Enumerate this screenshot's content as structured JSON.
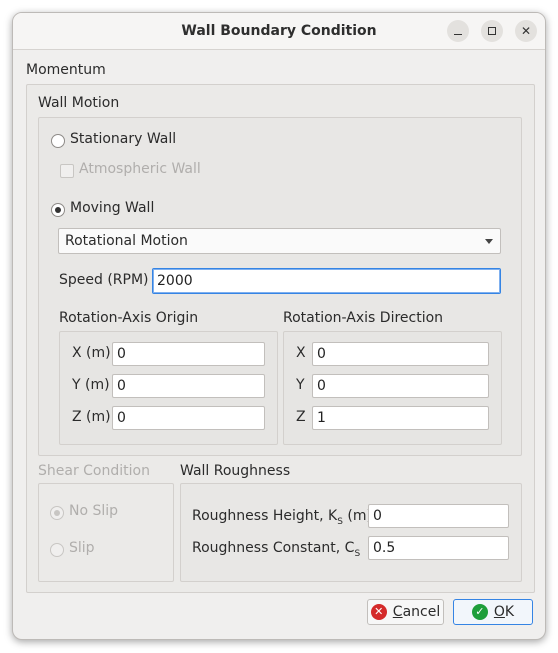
{
  "window": {
    "title": "Wall Boundary Condition",
    "controls": {
      "minimize": "minimize-icon",
      "maximize": "maximize-icon",
      "close": "close-icon"
    }
  },
  "momentum": {
    "label": "Momentum",
    "wall_motion": {
      "label": "Wall Motion",
      "stationary_wall": {
        "label": "Stationary Wall",
        "checked": false
      },
      "atmospheric_wall": {
        "label": "Atmospheric Wall",
        "checked": false,
        "enabled": false
      },
      "moving_wall": {
        "label": "Moving Wall",
        "checked": true
      },
      "motion_type": {
        "selected": "Rotational Motion"
      },
      "speed": {
        "label": "Speed (RPM)",
        "value": "2000"
      },
      "origin": {
        "label": "Rotation-Axis Origin",
        "x": {
          "label": "X (m)",
          "value": "0"
        },
        "y": {
          "label": "Y (m)",
          "value": "0"
        },
        "z": {
          "label": "Z (m)",
          "value": "0"
        }
      },
      "direction": {
        "label": "Rotation-Axis Direction",
        "x": {
          "label": "X",
          "value": "0"
        },
        "y": {
          "label": "Y",
          "value": "0"
        },
        "z": {
          "label": "Z",
          "value": "1"
        }
      }
    },
    "shear_condition": {
      "label": "Shear Condition",
      "enabled": false,
      "no_slip": {
        "label": "No Slip",
        "checked": true
      },
      "slip": {
        "label": "Slip",
        "checked": false
      }
    },
    "wall_roughness": {
      "label": "Wall Roughness",
      "height": {
        "label_main": "Roughness Height, K",
        "label_sub": "S",
        "label_tail": " (m)",
        "value": "0"
      },
      "constant": {
        "label_main": "Roughness Constant, C",
        "label_sub": "S",
        "value": "0.5"
      }
    }
  },
  "buttons": {
    "cancel": {
      "mnemonic": "C",
      "rest": "ancel",
      "icon": "cancel-icon"
    },
    "ok": {
      "mnemonic": "O",
      "rest": "K",
      "icon": "ok-icon"
    }
  },
  "colors": {
    "accent": "#3584e4",
    "cancel_icon": "#d42a2a",
    "ok_icon": "#1e9e3a"
  }
}
